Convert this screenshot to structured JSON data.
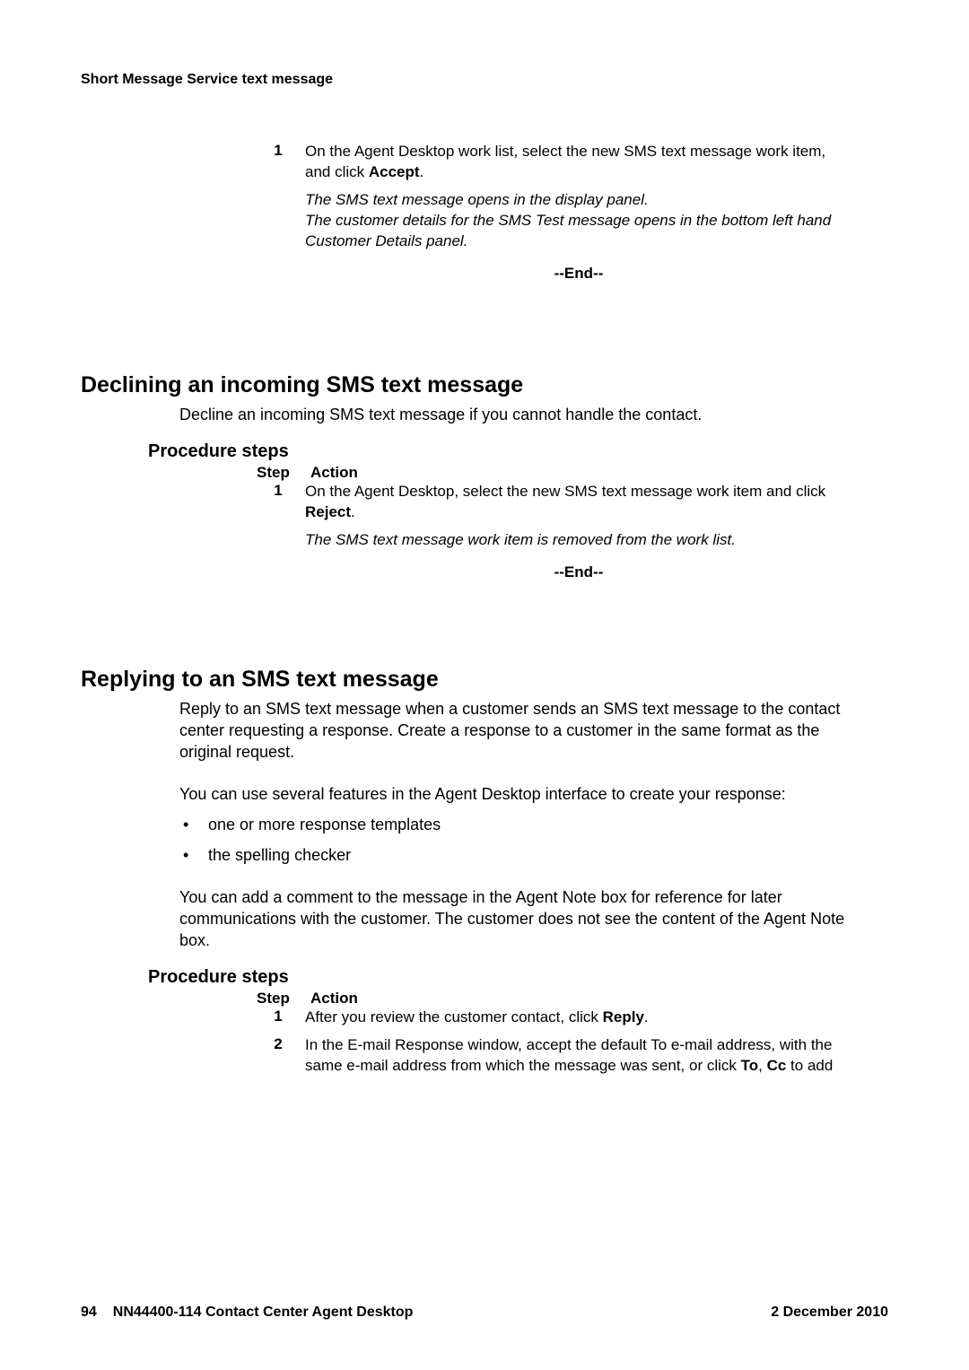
{
  "running_header": "Short Message Service text message",
  "section1": {
    "step1_num": "1",
    "step1_text_a": "On the Agent Desktop work list, select the new SMS text message work item, and click ",
    "step1_bold": "Accept",
    "step1_text_b": ".",
    "italic1": "The SMS text message opens in the display panel.",
    "italic2": "The customer details for the SMS Test message opens in the bottom left hand Customer Details panel.",
    "end": "--End--"
  },
  "section2": {
    "heading": "Declining an incoming SMS text message",
    "intro": "Decline an incoming SMS text message if you cannot handle the contact.",
    "proc_heading": "Procedure steps",
    "step_label": "Step",
    "action_label": "Action",
    "step1_num": "1",
    "step1_text_a": "On the Agent Desktop, select the new SMS text message work item and click ",
    "step1_bold": "Reject",
    "step1_text_b": ".",
    "italic1": "The SMS text message work item is removed from the work list.",
    "end": "--End--"
  },
  "section3": {
    "heading": "Replying to an SMS text message",
    "intro": "Reply to an SMS text message when a customer sends an SMS text message to the contact center requesting a response. Create a response to a customer in the same format as the original request.",
    "para2": "You can use several features in the Agent Desktop interface to create your response:",
    "bullet1": "one or more response templates",
    "bullet2": "the spelling checker",
    "para3": "You can add a comment to the message in the Agent Note box for reference for later communications with the customer. The customer does not see the content of the Agent Note box.",
    "proc_heading": "Procedure steps",
    "step_label": "Step",
    "action_label": "Action",
    "step1_num": "1",
    "step1_text_a": "After you review the customer contact, click ",
    "step1_bold": "Reply",
    "step1_text_b": ".",
    "step2_num": "2",
    "step2_text_a": "In the E-mail Response window, accept the default To e-mail address, with the same e-mail address from which the message was sent, or click ",
    "step2_bold1": "To",
    "step2_text_b": ", ",
    "step2_bold2": "Cc",
    "step2_text_c": " to add"
  },
  "footer": {
    "page_num": "94",
    "doc_id": "NN44400-114 Contact Center Agent Desktop",
    "date": "2 December 2010"
  }
}
